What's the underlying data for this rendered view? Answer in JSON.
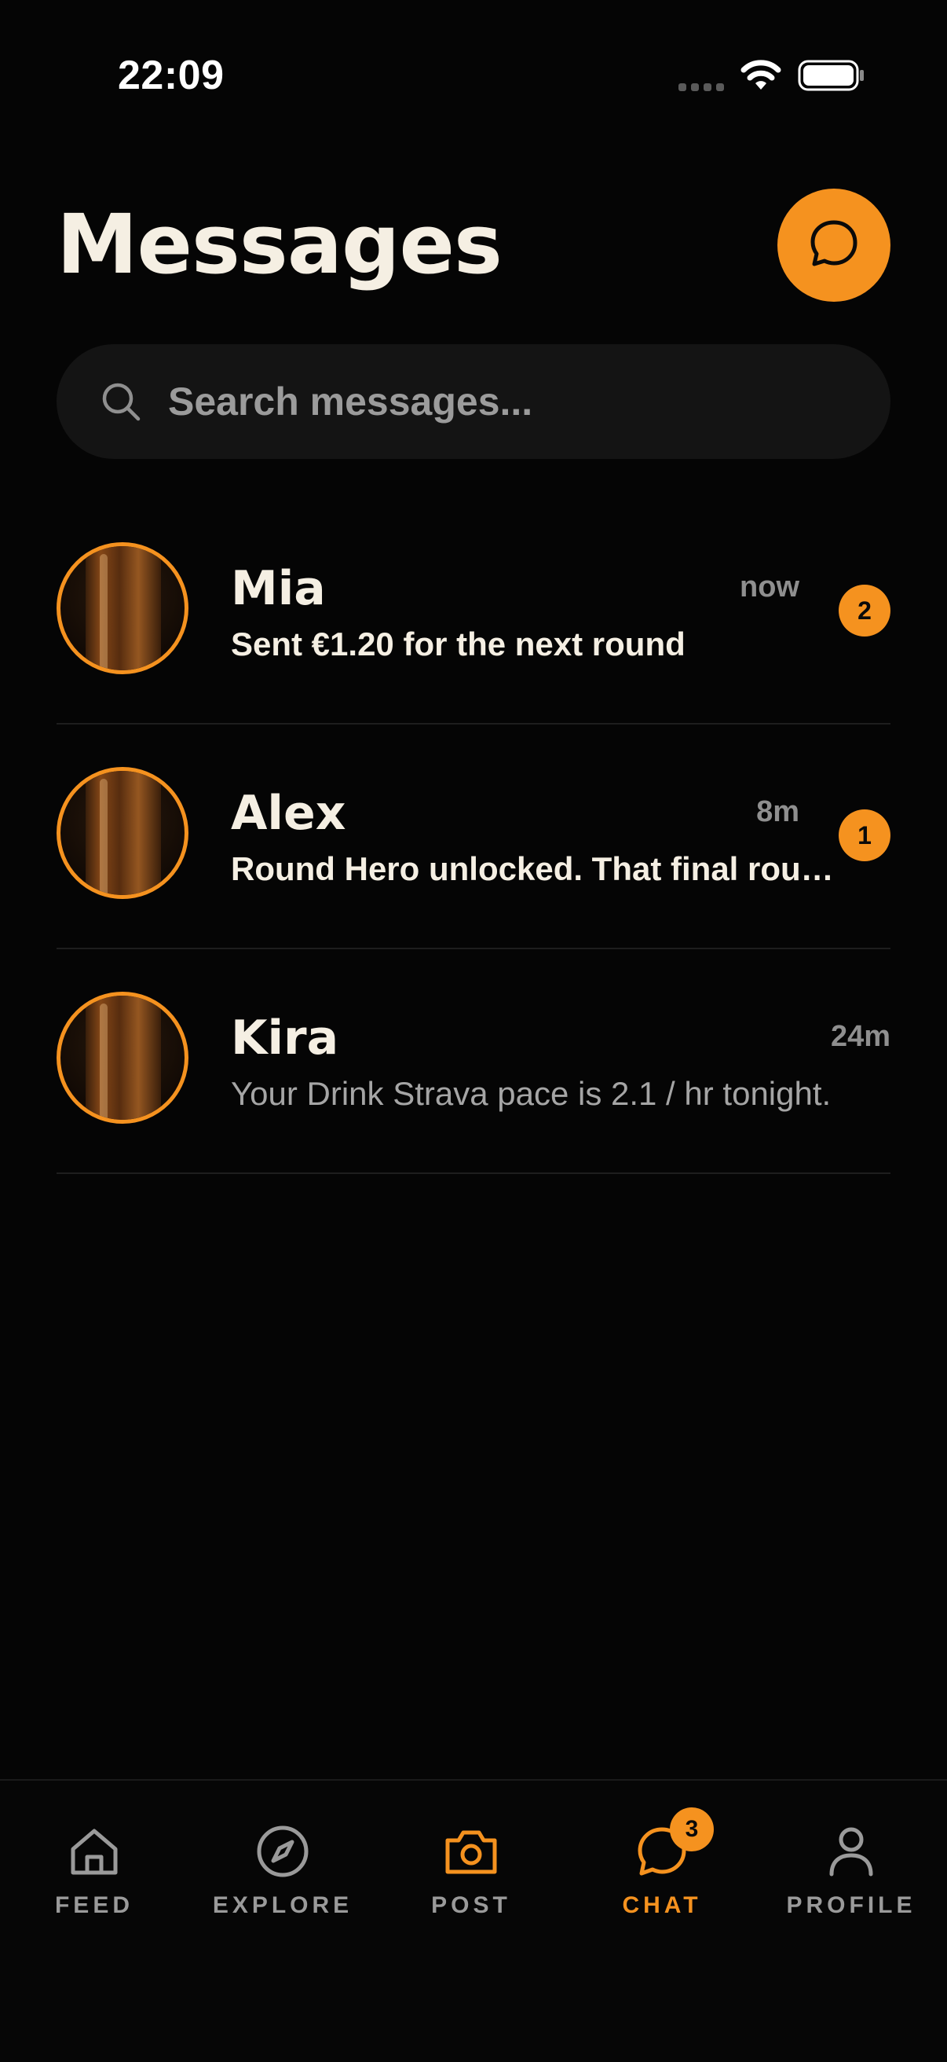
{
  "status_bar": {
    "time": "22:09"
  },
  "header": {
    "title": "Messages",
    "compose_icon": "chat-bubble-icon"
  },
  "search": {
    "placeholder": "Search messages..."
  },
  "conversations": [
    {
      "name": "Mia",
      "time": "now",
      "preview": "Sent €1.20 for the next round",
      "unread_count": "2",
      "unread": true
    },
    {
      "name": "Alex",
      "time": "8m",
      "preview": "Round Hero unlocked. That final round was elite.",
      "unread_count": "1",
      "unread": true
    },
    {
      "name": "Kira",
      "time": "24m",
      "preview": "Your Drink Strava pace is 2.1 / hr tonight.",
      "unread_count": "",
      "unread": false
    }
  ],
  "tab_bar": {
    "tabs": [
      {
        "label": "FEED",
        "icon": "home-icon"
      },
      {
        "label": "EXPLORE",
        "icon": "compass-icon"
      },
      {
        "label": "POST",
        "icon": "camera-icon"
      },
      {
        "label": "CHAT",
        "icon": "chat-bubble-icon",
        "badge": "3",
        "active": true
      },
      {
        "label": "PROFILE",
        "icon": "person-icon"
      }
    ]
  },
  "colors": {
    "accent": "#f5921f",
    "background": "#050505",
    "text_primary": "#f5efe3",
    "text_muted": "#8f8f8f"
  }
}
